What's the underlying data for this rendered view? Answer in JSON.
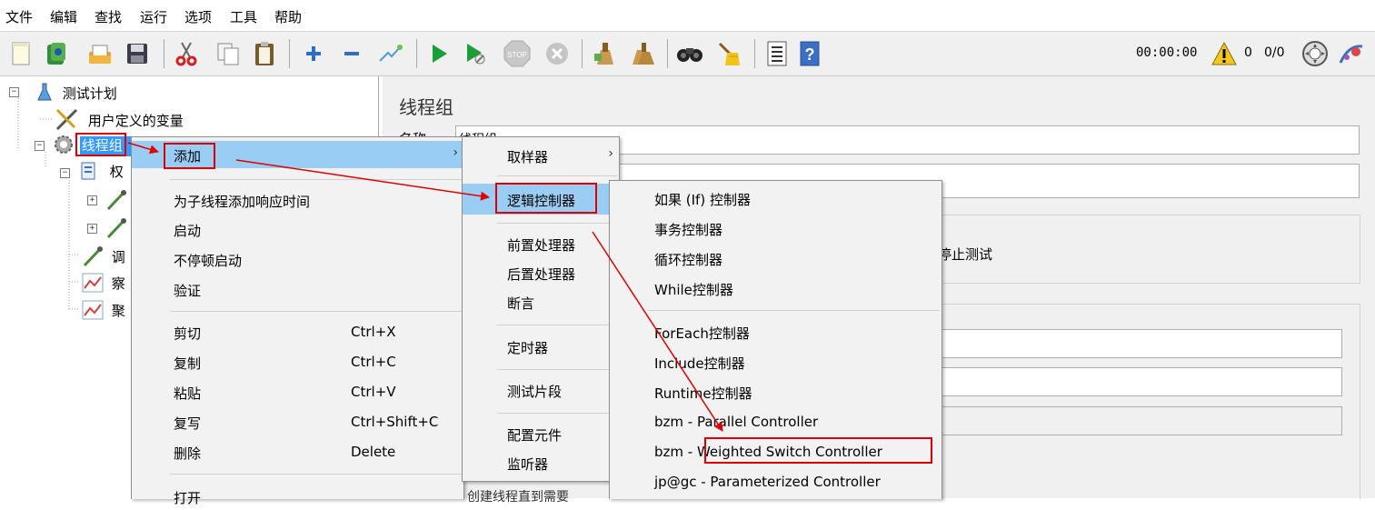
{
  "menubar": [
    "文件",
    "编辑",
    "查找",
    "运行",
    "选项",
    "工具",
    "帮助"
  ],
  "toolbar": {
    "icons": [
      "new-icon",
      "templates-icon",
      "open-icon",
      "save-icon",
      "cut-icon",
      "copy-icon",
      "paste-icon",
      "expand-icon",
      "collapse-icon",
      "toggle-icon",
      "start-icon",
      "start-no-pause-icon",
      "stop-icon",
      "shutdown-icon",
      "clear-icon",
      "clear-all-icon",
      "search-icon",
      "reset-search-icon",
      "function-helper-icon",
      "help-icon"
    ],
    "timer": "00:00:00",
    "warnings": "0",
    "threads": "0/0"
  },
  "tree": {
    "root": "测试计划",
    "items": [
      "用户定义的变量",
      "线程组",
      "权",
      "调",
      "察",
      "聚"
    ]
  },
  "right_panel": {
    "title": "线程组",
    "name_label": "名称",
    "name_value": "线程组",
    "stop_text": "停止测试"
  },
  "context_menu": {
    "items": [
      {
        "label": "添加",
        "shortcut": "",
        "submenu": true
      },
      {
        "label": "为子线程添加响应时间",
        "shortcut": ""
      },
      {
        "label": "启动",
        "shortcut": ""
      },
      {
        "label": "不停顿启动",
        "shortcut": ""
      },
      {
        "label": "验证",
        "shortcut": ""
      },
      {
        "label": "剪切",
        "shortcut": "Ctrl+X"
      },
      {
        "label": "复制",
        "shortcut": "Ctrl+C"
      },
      {
        "label": "粘贴",
        "shortcut": "Ctrl+V"
      },
      {
        "label": "复写",
        "shortcut": "Ctrl+Shift+C"
      },
      {
        "label": "删除",
        "shortcut": "Delete"
      },
      {
        "label": "打开",
        "shortcut": ""
      }
    ]
  },
  "add_submenu": {
    "items": [
      "取样器",
      "逻辑控制器",
      "前置处理器",
      "后置处理器",
      "断言",
      "定时器",
      "测试片段",
      "配置元件",
      "监听器"
    ],
    "partial_text": "创建线程直到需要"
  },
  "logic_submenu": {
    "items": [
      "如果 (If) 控制器",
      "事务控制器",
      "循环控制器",
      "While控制器",
      "ForEach控制器",
      "Include控制器",
      "Runtime控制器",
      "bzm - Parallel Controller",
      "bzm - Weighted Switch Controller",
      "jp@gc - Parameterized Controller"
    ]
  },
  "colors": {
    "highlight": "#99cdf3",
    "selected": "#3399ff",
    "annotation": "#e00000"
  }
}
